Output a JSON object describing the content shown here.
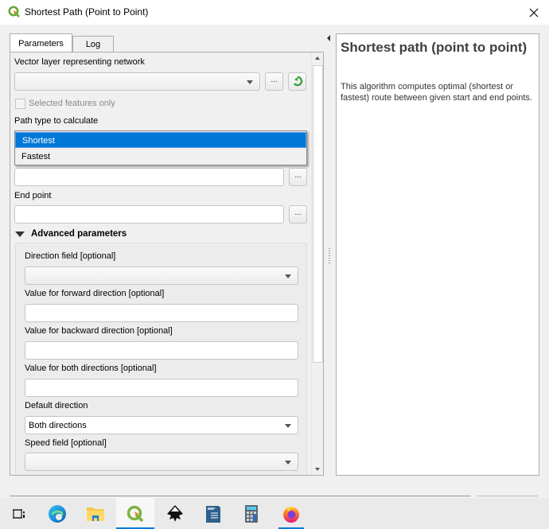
{
  "window": {
    "title": "Shortest Path (Point to Point)",
    "close_icon": "close-icon",
    "app_icon": "qgis-icon"
  },
  "tabs": [
    {
      "label": "Parameters",
      "active": true
    },
    {
      "label": "Log",
      "active": false
    }
  ],
  "params": {
    "network_label": "Vector layer representing network",
    "network_value": "",
    "browse_label": "...",
    "iterate_icon": "iterate-icon",
    "selected_only_label": "Selected features only",
    "selected_only_checked": false,
    "path_type_label": "Path type to calculate",
    "path_type_options": [
      "Shortest",
      "Fastest"
    ],
    "path_type_selected": "Shortest",
    "start_point_value": "",
    "end_point_label": "End point",
    "end_point_value": "",
    "advanced_label": "Advanced parameters",
    "direction_field_label": "Direction field [optional]",
    "direction_field_value": "",
    "forward_label": "Value for forward direction [optional]",
    "forward_value": "",
    "backward_label": "Value for backward direction [optional]",
    "backward_value": "",
    "both_label": "Value for both directions [optional]",
    "both_value": "",
    "default_direction_label": "Default direction",
    "default_direction_value": "Both directions",
    "speed_field_label": "Speed field [optional]",
    "speed_field_value": ""
  },
  "help": {
    "title": "Shortest path (point to point)",
    "description": "This algorithm computes optimal (shortest or fastest) route between given start and end points."
  },
  "taskbar": {
    "items": [
      {
        "name": "task-view",
        "icon": "task-view-icon"
      },
      {
        "name": "edge",
        "icon": "edge-icon"
      },
      {
        "name": "file-explorer",
        "icon": "folder-icon"
      },
      {
        "name": "qgis",
        "icon": "qgis-icon",
        "active": true
      },
      {
        "name": "inkscape",
        "icon": "inkscape-icon"
      },
      {
        "name": "libreoffice-writer",
        "icon": "writer-icon"
      },
      {
        "name": "calculator",
        "icon": "calculator-icon"
      },
      {
        "name": "firefox",
        "icon": "firefox-icon",
        "running": true
      }
    ]
  }
}
